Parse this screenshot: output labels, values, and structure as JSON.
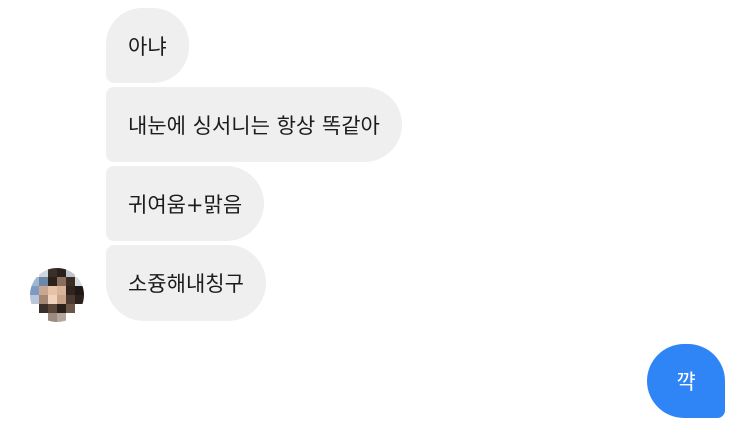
{
  "received_messages": [
    {
      "text": "아냐"
    },
    {
      "text": "내눈에 싱서니는 항상 똑같아"
    },
    {
      "text": "귀여움+맑음"
    },
    {
      "text": "소즁해내칭구"
    }
  ],
  "sent_messages": [
    {
      "text": "꺅"
    }
  ],
  "colors": {
    "received_bubble": "#efefef",
    "sent_bubble": "#2f85f6",
    "background": "#ffffff"
  },
  "avatar": {
    "icon": "pixelated-avatar-icon",
    "pixels": [
      "#ffffff",
      "#cfd6e0",
      "#3a2f2a",
      "#2a211c",
      "#bfc4cc",
      "#ffffff",
      "#9fb6d2",
      "#6f88a8",
      "#2b211b",
      "#8a6d5c",
      "#3a2d25",
      "#d8dde3",
      "#7d9bc2",
      "#c9a690",
      "#e6c2a9",
      "#d9b49a",
      "#2f241e",
      "#1f1814",
      "#b7c6d8",
      "#a48874",
      "#f0d2bd",
      "#c9a48a",
      "#4a3a30",
      "#2b221c",
      "#ffffff",
      "#3b2f29",
      "#5b4638",
      "#2a201a",
      "#6b574a",
      "#ffffff",
      "#ffffff",
      "#ffffff",
      "#9a8a80",
      "#b5a69c",
      "#ffffff",
      "#ffffff"
    ]
  }
}
